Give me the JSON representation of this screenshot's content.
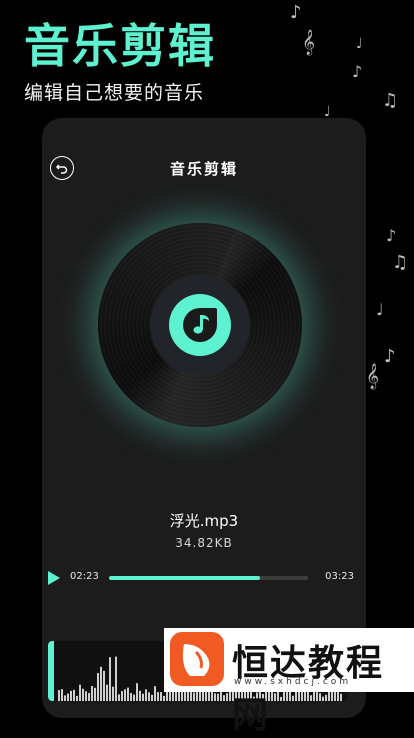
{
  "hero": {
    "title": "音乐剪辑",
    "subtitle": "编辑自己想要的音乐"
  },
  "screen": {
    "title": "音乐剪辑",
    "back_icon": "back-arrow-icon",
    "disc_icon": "music-note-icon"
  },
  "file": {
    "name": "浮光.mp3",
    "size": "34.82KB"
  },
  "player": {
    "current_time": "02:23",
    "total_time": "03:23",
    "progress": 0.76
  },
  "watermark": {
    "text": "恒达教程网",
    "url": "www.sxhdcj.com"
  },
  "colors": {
    "accent": "#5FF2D0",
    "background": "#000000",
    "card": "#1C1C1C",
    "watermark_logo": "#F15A22"
  }
}
